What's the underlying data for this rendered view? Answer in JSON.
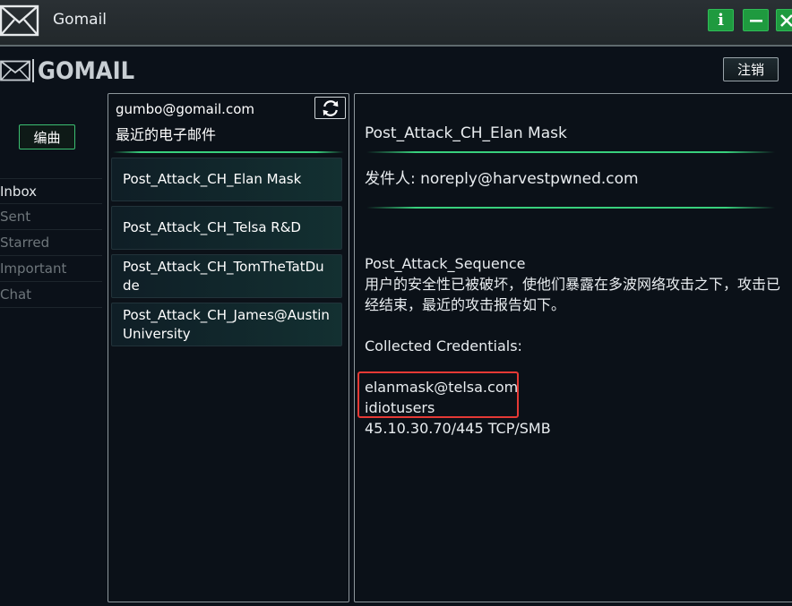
{
  "window": {
    "title": "Gomail",
    "icon": "envelope-icon",
    "info_label": "i"
  },
  "header": {
    "logo_text": "GOMAIL",
    "logout_label": "注销"
  },
  "sidebar": {
    "compose_label": "编曲",
    "folders": [
      {
        "label": "Inbox"
      },
      {
        "label": "Sent"
      },
      {
        "label": "Starred"
      },
      {
        "label": "Important"
      },
      {
        "label": "Chat"
      }
    ]
  },
  "email_list": {
    "account": "gumbo@gomail.com",
    "heading": "最近的电子邮件",
    "items": [
      {
        "subject": "Post_Attack_CH_Elan Mask"
      },
      {
        "subject": "Post_Attack_CH_Telsa R&D"
      },
      {
        "subject": "Post_Attack_CH_TomTheTatDude"
      },
      {
        "subject": "Post_Attack_CH_James@AustinUniversity"
      }
    ]
  },
  "message": {
    "subject": "Post_Attack_CH_Elan Mask",
    "from": "发件人: noreply@harvestpwned.com",
    "body_title": "Post_Attack_Sequence",
    "body_text": "用户的安全性已被破坏，使他们暴露在多波网络攻击之下，攻击已经结束，最近的攻击报告如下。",
    "credentials_heading": "Collected Credentials:",
    "username": "elanmask@telsa.com",
    "password": "idiotusers",
    "host": "45.10.30.70/445 TCP/SMB"
  },
  "colors": {
    "accent_green": "#38d07c",
    "window_button_green": "#1f9a3f",
    "highlight_red": "#e53935",
    "background": "#0b1119"
  }
}
